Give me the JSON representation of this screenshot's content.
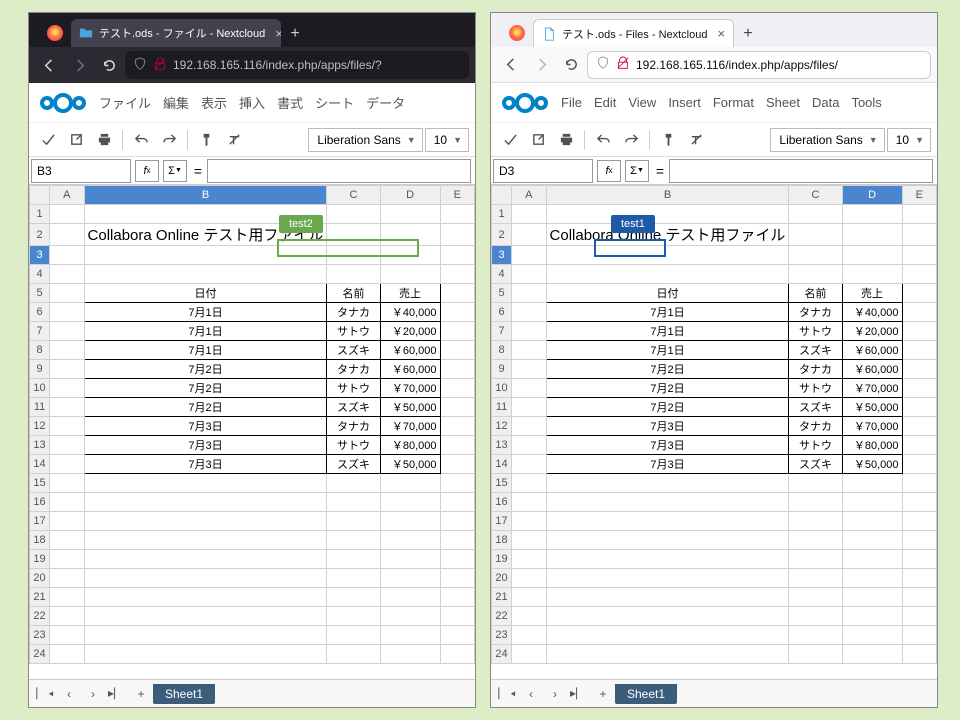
{
  "left": {
    "browser_tab_title": "テスト.ods - ファイル - Nextcloud",
    "url_display": "192.168.165.116/index.php/apps/files/?",
    "menu": [
      "ファイル",
      "編集",
      "表示",
      "挿入",
      "書式",
      "シート",
      "データ"
    ],
    "font_name": "Liberation Sans",
    "font_size": "10",
    "cell_ref": "B3",
    "selected_col": "B",
    "selected_row": "3",
    "comment_user": "test2",
    "sheet_tab": "Sheet1"
  },
  "right": {
    "browser_tab_title": "テスト.ods - Files - Nextcloud",
    "url_display": "192.168.165.116/index.php/apps/files/",
    "menu": [
      "File",
      "Edit",
      "View",
      "Insert",
      "Format",
      "Sheet",
      "Data",
      "Tools"
    ],
    "font_name": "Liberation Sans",
    "font_size": "10",
    "cell_ref": "D3",
    "selected_col": "D",
    "selected_row": "3",
    "comment_user": "test1",
    "sheet_tab": "Sheet1"
  },
  "columns": [
    "A",
    "B",
    "C",
    "D",
    "E"
  ],
  "title_text": "Collabora Online テスト用ファイル",
  "table": {
    "headers": [
      "日付",
      "名前",
      "売上"
    ],
    "rows": [
      {
        "date": "7月1日",
        "name": "タナカ",
        "sales": "￥40,000"
      },
      {
        "date": "7月1日",
        "name": "サトウ",
        "sales": "￥20,000"
      },
      {
        "date": "7月1日",
        "name": "スズキ",
        "sales": "￥60,000"
      },
      {
        "date": "7月2日",
        "name": "タナカ",
        "sales": "￥60,000"
      },
      {
        "date": "7月2日",
        "name": "サトウ",
        "sales": "￥70,000"
      },
      {
        "date": "7月2日",
        "name": "スズキ",
        "sales": "￥50,000"
      },
      {
        "date": "7月3日",
        "name": "タナカ",
        "sales": "￥70,000"
      },
      {
        "date": "7月3日",
        "name": "サトウ",
        "sales": "￥80,000"
      },
      {
        "date": "7月3日",
        "name": "スズキ",
        "sales": "￥50,000"
      }
    ]
  },
  "row_count": 24
}
